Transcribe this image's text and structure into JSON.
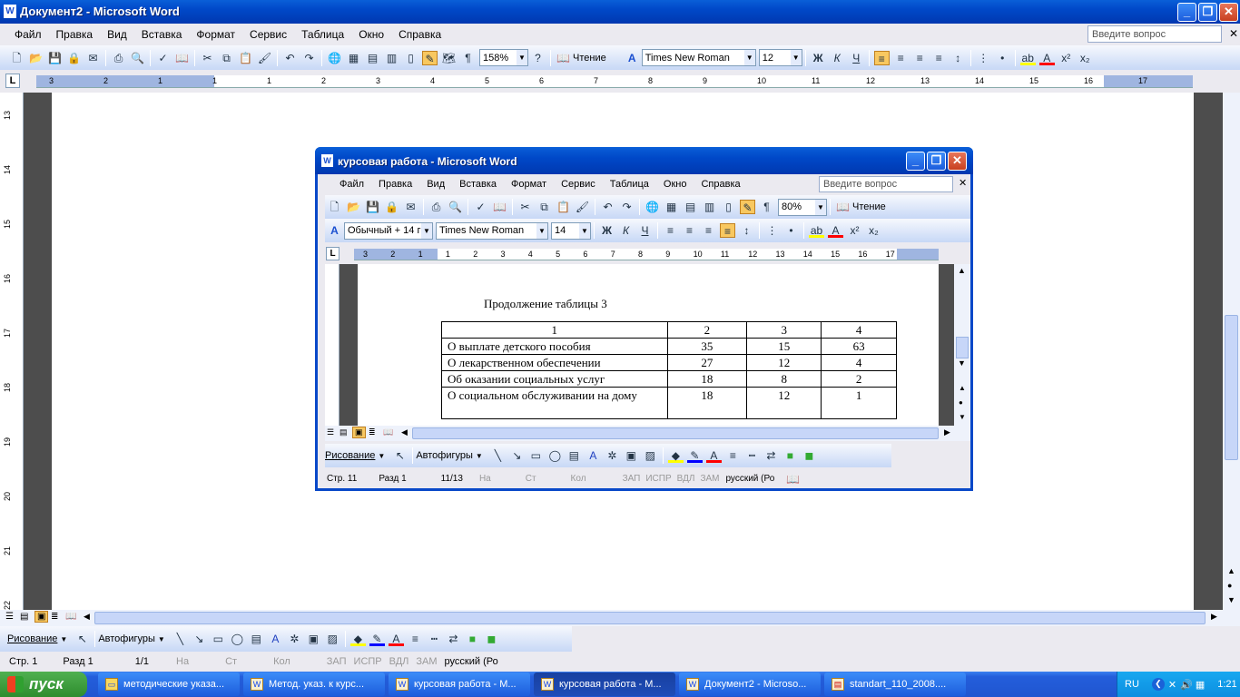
{
  "main": {
    "title": "Документ2 - Microsoft Word",
    "menu": [
      "Файл",
      "Правка",
      "Вид",
      "Вставка",
      "Формат",
      "Сервис",
      "Таблица",
      "Окно",
      "Справка"
    ],
    "ask_placeholder": "Введите вопрос",
    "zoom": "158%",
    "reading": "Чтение",
    "font": "Times New Roman",
    "size": "12",
    "ruler_numbers": [
      "3",
      "2",
      "1",
      "1",
      "1",
      "2",
      "3",
      "4",
      "5",
      "6",
      "7",
      "8",
      "9",
      "10",
      "11",
      "12",
      "13",
      "14",
      "15",
      "16",
      "17"
    ],
    "vruler_numbers": [
      "13",
      "14",
      "15",
      "16",
      "17",
      "18",
      "19",
      "20",
      "21",
      "22"
    ],
    "drawing": {
      "label": "Рисование",
      "autoshapes": "Автофигуры"
    },
    "status": {
      "page": "Стр. 1",
      "section": "Разд 1",
      "pages": "1/1",
      "at": "На",
      "ln": "Ст",
      "col": "Кол",
      "rec": "ЗАП",
      "trk": "ИСПР",
      "ext": "ВДЛ",
      "ovr": "ЗАМ",
      "lang": "русский (Ро"
    }
  },
  "inner": {
    "title": "курсовая работа - Microsoft Word",
    "menu": [
      "Файл",
      "Правка",
      "Вид",
      "Вставка",
      "Формат",
      "Сервис",
      "Таблица",
      "Окно",
      "Справка"
    ],
    "ask_placeholder": "Введите вопрос",
    "zoom": "80%",
    "reading": "Чтение",
    "style": "Обычный + 14 г",
    "font": "Times New Roman",
    "size": "14",
    "ruler_numbers": [
      "3",
      "2",
      "1",
      "1",
      "2",
      "3",
      "4",
      "5",
      "6",
      "7",
      "8",
      "9",
      "10",
      "11",
      "12",
      "13",
      "14",
      "15",
      "16",
      "17"
    ],
    "caption": "Продолжение таблицы 3",
    "table": [
      [
        "1",
        "2",
        "3",
        "4"
      ],
      [
        "О выплате детского пособия",
        "35",
        "15",
        "63"
      ],
      [
        "О лекарственном обеспечении",
        "27",
        "12",
        "4"
      ],
      [
        "Об оказании социальных услуг",
        "18",
        "8",
        "2"
      ],
      [
        "О социальном обслуживании на дому",
        "18",
        "12",
        "1"
      ]
    ],
    "drawing": {
      "label": "Рисование",
      "autoshapes": "Автофигуры"
    },
    "status": {
      "page": "Стр. 11",
      "section": "Разд 1",
      "pages": "11/13",
      "at": "На",
      "ln": "Ст",
      "col": "Кол",
      "rec": "ЗАП",
      "trk": "ИСПР",
      "ext": "ВДЛ",
      "ovr": "ЗАМ",
      "lang": "русский (Ро"
    }
  },
  "taskbar": {
    "start": "пуск",
    "buttons": [
      "методические указа...",
      "Метод. указ. к курс...",
      "курсовая работа - М...",
      "курсовая работа - М...",
      "Документ2 - Microso...",
      "standart_110_2008...."
    ],
    "lang": "RU",
    "clock": "1:21"
  },
  "colors": {
    "titlebar": "#0048c8",
    "doc": "#ffffff",
    "workspace": "#4d4d4d",
    "taskbar": "#245edb",
    "start": "#3c9c3c"
  }
}
